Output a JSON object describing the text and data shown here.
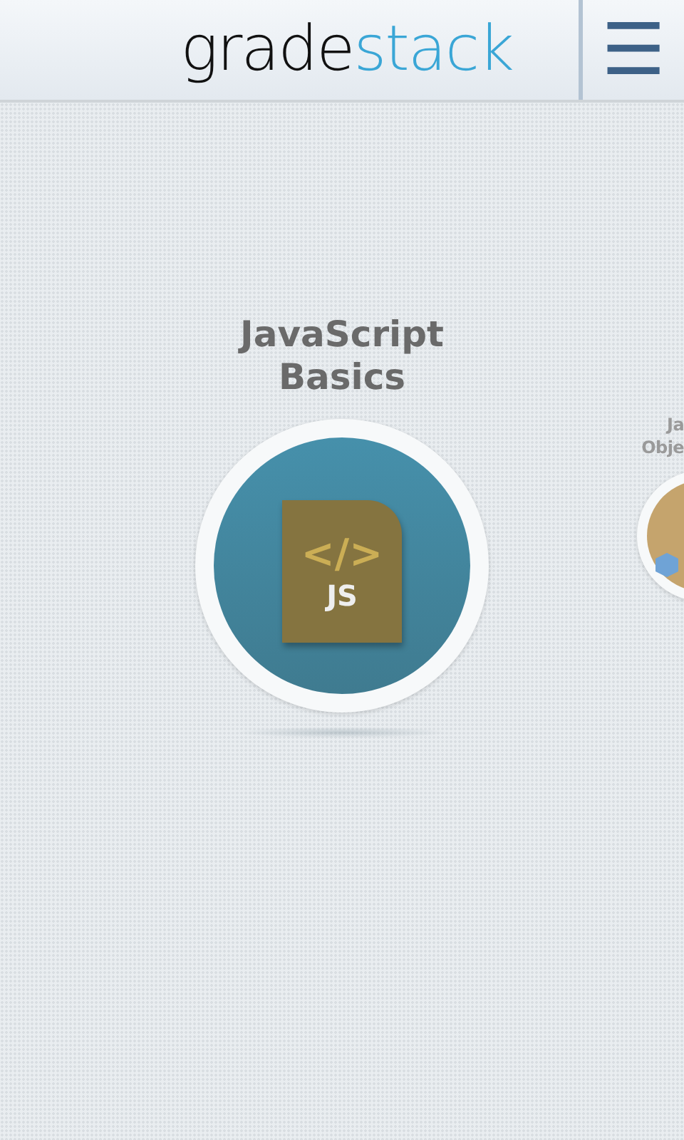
{
  "header": {
    "logo": {
      "part_1": "grade",
      "part_2": "stack"
    },
    "menu_button": {
      "label": "☰"
    }
  },
  "courses": [
    {
      "title_lines": [
        "JavaScript",
        "Basics"
      ],
      "kind": "javascript",
      "icon_symbol": "</>",
      "icon_label": "JS",
      "selected": true
    },
    {
      "title_lines": [
        "Ja",
        "Obje"
      ],
      "kind": "objects",
      "selected": false
    }
  ]
}
